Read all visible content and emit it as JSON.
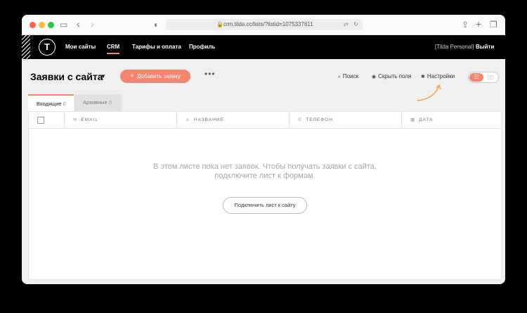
{
  "browser": {
    "url": "crm.tilda.cc/lists/?listid=1075337611",
    "traffic_lights": {
      "close": "#ff5f57",
      "minimize": "#febc2e",
      "zoom": "#28c840"
    }
  },
  "nav": {
    "logo_letter": "T",
    "items": [
      {
        "label": "Мои сайты"
      },
      {
        "label": "CRM"
      },
      {
        "label": "Тарифы и оплата"
      },
      {
        "label": "Профиль"
      }
    ],
    "account": "[Tilda Personal]",
    "logout": "Выйти"
  },
  "page": {
    "title": "Заявки с сайта",
    "add_button": "Добавить заявку",
    "more": "•••",
    "search": "Поиск",
    "hide_fields": "Скрыть поля",
    "settings": "Настройки"
  },
  "tabs": [
    {
      "label": "Входящие",
      "count": "0"
    },
    {
      "label": "Архивные",
      "count": "0"
    }
  ],
  "table": {
    "columns": [
      {
        "label": "EMAIL",
        "icon": "envelope-icon"
      },
      {
        "label": "НАЗВАНИЕ",
        "icon": "person-icon"
      },
      {
        "label": "ТЕЛЕФОН",
        "icon": "phone-icon"
      },
      {
        "label": "ДАТА",
        "icon": "calendar-icon"
      }
    ],
    "empty_line1": "В этом листе пока нет заявок. Чтобы получать заявки с сайта,",
    "empty_line2": "подключите лист к формам.",
    "connect_button": "Подключить лист к сайту"
  },
  "colors": {
    "accent": "#f4846b",
    "nav_bg": "#000000",
    "content_bg": "#f0f0f0"
  }
}
